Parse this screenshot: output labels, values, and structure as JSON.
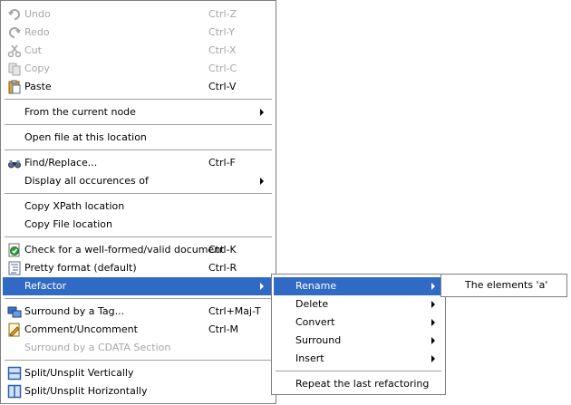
{
  "main_menu": {
    "items": [
      {
        "label": "Undo",
        "shortcut": "Ctrl-Z"
      },
      {
        "label": "Redo",
        "shortcut": "Ctrl-Y"
      },
      {
        "label": "Cut",
        "shortcut": "Ctrl-X"
      },
      {
        "label": "Copy",
        "shortcut": "Ctrl-C"
      },
      {
        "label": "Paste",
        "shortcut": "Ctrl-V"
      },
      {
        "label": "From the current node"
      },
      {
        "label": "Open file at this location"
      },
      {
        "label": "Find/Replace...",
        "shortcut": "Ctrl-F"
      },
      {
        "label": "Display all occurences of"
      },
      {
        "label": "Copy XPath location"
      },
      {
        "label": "Copy File location"
      },
      {
        "label": "Check for a well-formed/valid document",
        "shortcut": "Ctrl-K"
      },
      {
        "label": "Pretty format (default)",
        "shortcut": "Ctrl-R"
      },
      {
        "label": "Refactor"
      },
      {
        "label": "Surround by a Tag...",
        "shortcut": "Ctrl+Maj-T"
      },
      {
        "label": "Comment/Uncomment",
        "shortcut": "Ctrl-M"
      },
      {
        "label": "Surround by a CDATA Section"
      },
      {
        "label": "Split/Unsplit Vertically"
      },
      {
        "label": "Split/Unsplit Horizontally"
      }
    ]
  },
  "refactor_menu": {
    "items": [
      {
        "label": "Rename"
      },
      {
        "label": "Delete"
      },
      {
        "label": "Convert"
      },
      {
        "label": "Surround"
      },
      {
        "label": "Insert"
      },
      {
        "label": "Repeat the last refactoring"
      }
    ]
  },
  "rename_menu": {
    "items": [
      {
        "label": "The elements 'a'"
      }
    ]
  },
  "colors": {
    "highlight": "#316ac5",
    "disabled_text": "#a6a6a6",
    "border": "#7f7f7f"
  }
}
